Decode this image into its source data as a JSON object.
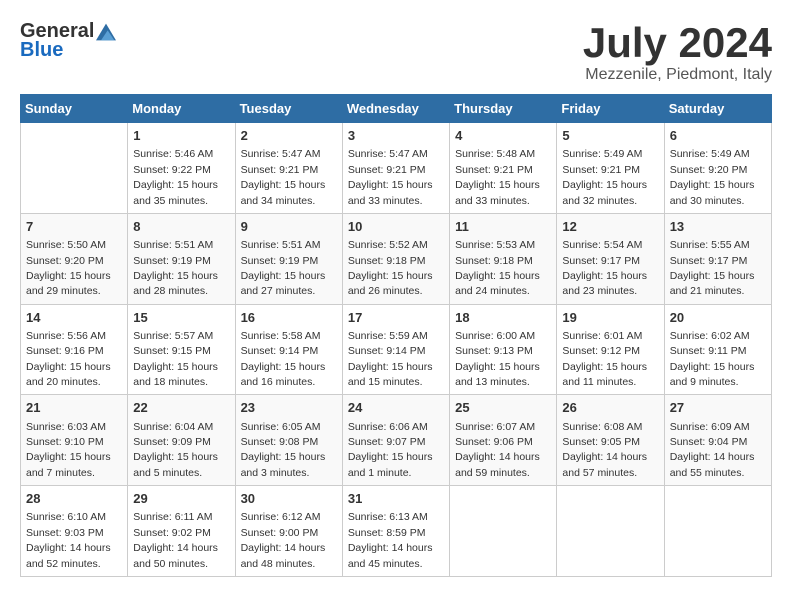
{
  "logo": {
    "general": "General",
    "blue": "Blue"
  },
  "header": {
    "month_year": "July 2024",
    "location": "Mezzenile, Piedmont, Italy"
  },
  "days_of_week": [
    "Sunday",
    "Monday",
    "Tuesday",
    "Wednesday",
    "Thursday",
    "Friday",
    "Saturday"
  ],
  "weeks": [
    [
      {
        "day": "",
        "info": ""
      },
      {
        "day": "1",
        "info": "Sunrise: 5:46 AM\nSunset: 9:22 PM\nDaylight: 15 hours\nand 35 minutes."
      },
      {
        "day": "2",
        "info": "Sunrise: 5:47 AM\nSunset: 9:21 PM\nDaylight: 15 hours\nand 34 minutes."
      },
      {
        "day": "3",
        "info": "Sunrise: 5:47 AM\nSunset: 9:21 PM\nDaylight: 15 hours\nand 33 minutes."
      },
      {
        "day": "4",
        "info": "Sunrise: 5:48 AM\nSunset: 9:21 PM\nDaylight: 15 hours\nand 33 minutes."
      },
      {
        "day": "5",
        "info": "Sunrise: 5:49 AM\nSunset: 9:21 PM\nDaylight: 15 hours\nand 32 minutes."
      },
      {
        "day": "6",
        "info": "Sunrise: 5:49 AM\nSunset: 9:20 PM\nDaylight: 15 hours\nand 30 minutes."
      }
    ],
    [
      {
        "day": "7",
        "info": "Sunrise: 5:50 AM\nSunset: 9:20 PM\nDaylight: 15 hours\nand 29 minutes."
      },
      {
        "day": "8",
        "info": "Sunrise: 5:51 AM\nSunset: 9:19 PM\nDaylight: 15 hours\nand 28 minutes."
      },
      {
        "day": "9",
        "info": "Sunrise: 5:51 AM\nSunset: 9:19 PM\nDaylight: 15 hours\nand 27 minutes."
      },
      {
        "day": "10",
        "info": "Sunrise: 5:52 AM\nSunset: 9:18 PM\nDaylight: 15 hours\nand 26 minutes."
      },
      {
        "day": "11",
        "info": "Sunrise: 5:53 AM\nSunset: 9:18 PM\nDaylight: 15 hours\nand 24 minutes."
      },
      {
        "day": "12",
        "info": "Sunrise: 5:54 AM\nSunset: 9:17 PM\nDaylight: 15 hours\nand 23 minutes."
      },
      {
        "day": "13",
        "info": "Sunrise: 5:55 AM\nSunset: 9:17 PM\nDaylight: 15 hours\nand 21 minutes."
      }
    ],
    [
      {
        "day": "14",
        "info": "Sunrise: 5:56 AM\nSunset: 9:16 PM\nDaylight: 15 hours\nand 20 minutes."
      },
      {
        "day": "15",
        "info": "Sunrise: 5:57 AM\nSunset: 9:15 PM\nDaylight: 15 hours\nand 18 minutes."
      },
      {
        "day": "16",
        "info": "Sunrise: 5:58 AM\nSunset: 9:14 PM\nDaylight: 15 hours\nand 16 minutes."
      },
      {
        "day": "17",
        "info": "Sunrise: 5:59 AM\nSunset: 9:14 PM\nDaylight: 15 hours\nand 15 minutes."
      },
      {
        "day": "18",
        "info": "Sunrise: 6:00 AM\nSunset: 9:13 PM\nDaylight: 15 hours\nand 13 minutes."
      },
      {
        "day": "19",
        "info": "Sunrise: 6:01 AM\nSunset: 9:12 PM\nDaylight: 15 hours\nand 11 minutes."
      },
      {
        "day": "20",
        "info": "Sunrise: 6:02 AM\nSunset: 9:11 PM\nDaylight: 15 hours\nand 9 minutes."
      }
    ],
    [
      {
        "day": "21",
        "info": "Sunrise: 6:03 AM\nSunset: 9:10 PM\nDaylight: 15 hours\nand 7 minutes."
      },
      {
        "day": "22",
        "info": "Sunrise: 6:04 AM\nSunset: 9:09 PM\nDaylight: 15 hours\nand 5 minutes."
      },
      {
        "day": "23",
        "info": "Sunrise: 6:05 AM\nSunset: 9:08 PM\nDaylight: 15 hours\nand 3 minutes."
      },
      {
        "day": "24",
        "info": "Sunrise: 6:06 AM\nSunset: 9:07 PM\nDaylight: 15 hours\nand 1 minute."
      },
      {
        "day": "25",
        "info": "Sunrise: 6:07 AM\nSunset: 9:06 PM\nDaylight: 14 hours\nand 59 minutes."
      },
      {
        "day": "26",
        "info": "Sunrise: 6:08 AM\nSunset: 9:05 PM\nDaylight: 14 hours\nand 57 minutes."
      },
      {
        "day": "27",
        "info": "Sunrise: 6:09 AM\nSunset: 9:04 PM\nDaylight: 14 hours\nand 55 minutes."
      }
    ],
    [
      {
        "day": "28",
        "info": "Sunrise: 6:10 AM\nSunset: 9:03 PM\nDaylight: 14 hours\nand 52 minutes."
      },
      {
        "day": "29",
        "info": "Sunrise: 6:11 AM\nSunset: 9:02 PM\nDaylight: 14 hours\nand 50 minutes."
      },
      {
        "day": "30",
        "info": "Sunrise: 6:12 AM\nSunset: 9:00 PM\nDaylight: 14 hours\nand 48 minutes."
      },
      {
        "day": "31",
        "info": "Sunrise: 6:13 AM\nSunset: 8:59 PM\nDaylight: 14 hours\nand 45 minutes."
      },
      {
        "day": "",
        "info": ""
      },
      {
        "day": "",
        "info": ""
      },
      {
        "day": "",
        "info": ""
      }
    ]
  ]
}
